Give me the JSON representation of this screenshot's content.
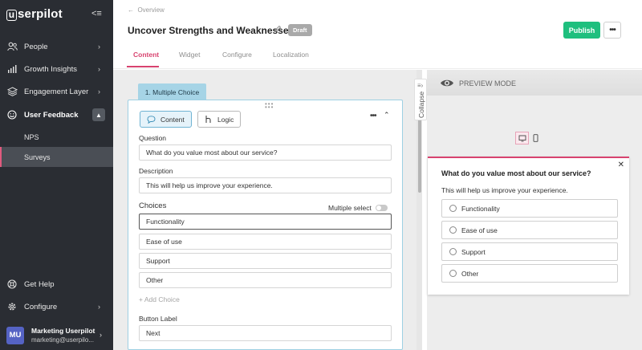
{
  "sidebar": {
    "logo": "serpilot",
    "logo_letter": "u",
    "collapse_glyph": "<≡",
    "items": [
      {
        "label": "People",
        "icon": "people-icon"
      },
      {
        "label": "Growth Insights",
        "icon": "bar-chart-icon"
      },
      {
        "label": "Engagement Layer",
        "icon": "layers-icon"
      },
      {
        "label": "User Feedback",
        "icon": "smile-icon"
      }
    ],
    "subitems": [
      {
        "label": "NPS"
      },
      {
        "label": "Surveys"
      }
    ],
    "bottom": [
      {
        "label": "Get Help",
        "icon": "help-icon"
      },
      {
        "label": "Configure",
        "icon": "gear-icon"
      }
    ],
    "user": {
      "initials": "MU",
      "name": "Marketing Userpilot",
      "email": "marketing@userpilo..."
    }
  },
  "header": {
    "breadcrumb": "Overview",
    "title": "Uncover Strengths and Weaknesses",
    "status": "Draft",
    "publish_label": "Publish",
    "more_label": "•••",
    "tabs": [
      {
        "label": "Content",
        "active": true
      },
      {
        "label": "Widget"
      },
      {
        "label": "Configure"
      },
      {
        "label": "Localization"
      }
    ]
  },
  "editor": {
    "step_tab": "1. Multiple Choice",
    "content_btn": "Content",
    "logic_btn": "Logic",
    "question_label": "Question",
    "question_value": "What do you value most about our service?",
    "description_label": "Description",
    "description_value": "This will help us improve your experience.",
    "choices_label": "Choices",
    "multiple_select_label": "Multiple select",
    "multiple_select_on": false,
    "choices": [
      "Functionality",
      "Ease of use",
      "Support",
      "Other"
    ],
    "add_choice": "+ Add Choice",
    "button_label_label": "Button Label",
    "button_label_value": "Next",
    "collapse_label": "Collapse"
  },
  "preview": {
    "mode_label": "PREVIEW MODE",
    "question": "What do you value most about our service?",
    "description": "This will help us improve your experience.",
    "options": [
      "Functionality",
      "Ease of use",
      "Support",
      "Other"
    ],
    "accent_color": "#d8436f"
  },
  "colors": {
    "sidebar_bg": "#2a2d33",
    "publish_green": "#1fbf7e",
    "tab_accent": "#d8436f",
    "step_tab_bg": "#a6d4e6"
  }
}
